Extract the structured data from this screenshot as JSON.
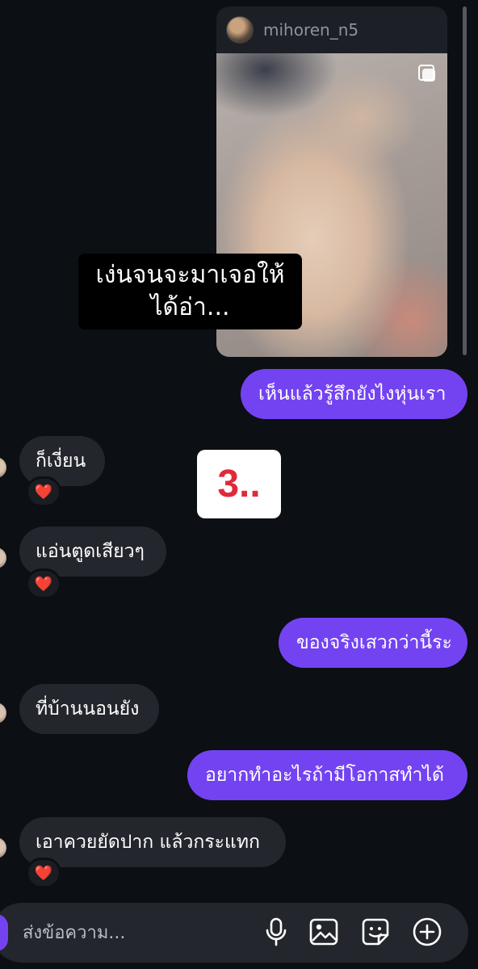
{
  "post": {
    "username": "mihoren_n5",
    "caption_lines": [
      "เง่นจนจะมาเจอให้",
      "ได้อ่า..."
    ]
  },
  "sticker": {
    "text": "3.."
  },
  "messages": [
    {
      "from": "me",
      "text": "เห็นแล้วรู้สึกยังไงหุ่นเรา"
    },
    {
      "from": "them",
      "text": "ก็เงี่ยน",
      "reaction": "❤️"
    },
    {
      "from": "them",
      "text": "แอ่นตูดเสียวๆ",
      "reaction": "❤️"
    },
    {
      "from": "me",
      "text": "ของจริงเสวกว่านี้ระ"
    },
    {
      "from": "them",
      "text": "ที่บ้านนอนยัง"
    },
    {
      "from": "me",
      "text": "อยากทำอะไรถ้ามีโอกาสทำได้"
    },
    {
      "from": "them",
      "text": "เอาควยยัดปาก แล้วกระแทก",
      "reaction": "❤️"
    }
  ],
  "composer": {
    "placeholder": "ส่งข้อความ...",
    "icons": [
      "microphone-icon",
      "image-icon",
      "sticker-icon",
      "plus-icon"
    ]
  },
  "colors": {
    "background": "#0c0f14",
    "outgoing_bubble": "#7343f2",
    "incoming_bubble": "#23262c",
    "sticker_text": "#e02a3a"
  }
}
